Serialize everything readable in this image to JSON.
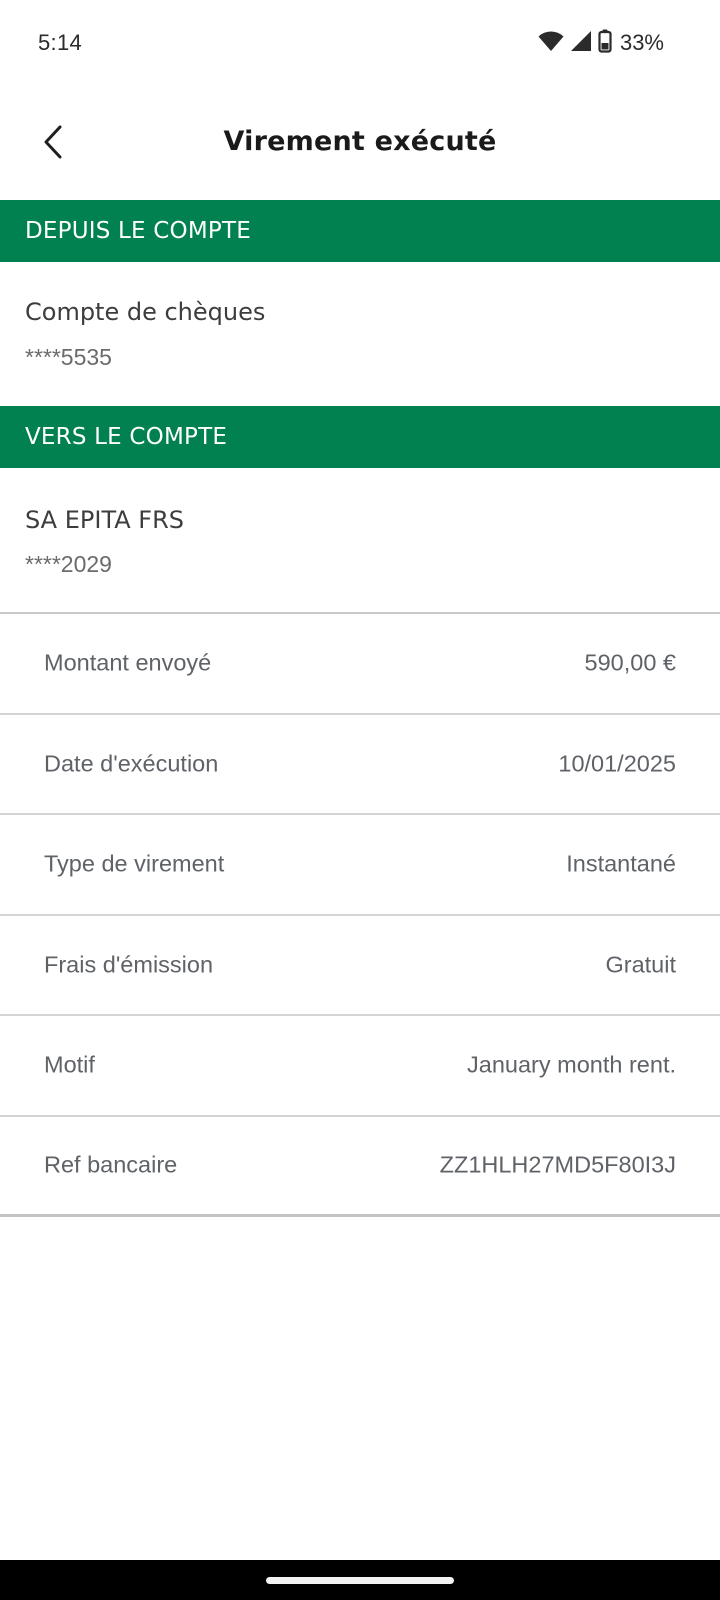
{
  "status_bar": {
    "time": "5:14",
    "battery_percent": "33%",
    "icons": [
      "wifi-icon",
      "signal-icon",
      "battery-icon"
    ]
  },
  "header": {
    "title": "Virement exécuté",
    "back_icon": "chevron-left-icon"
  },
  "from_account": {
    "section_label": "DEPUIS LE COMPTE",
    "name": "Compte de chèques",
    "number": "****5535"
  },
  "to_account": {
    "section_label": "VERS LE COMPTE",
    "name": "SA EPITA FRS",
    "number": "****2029"
  },
  "details": [
    {
      "label": "Montant envoyé",
      "value": "590,00 €"
    },
    {
      "label": "Date d'exécution",
      "value": "10/01/2025"
    },
    {
      "label": "Type de virement",
      "value": "Instantané"
    },
    {
      "label": "Frais d'émission",
      "value": "Gratuit"
    },
    {
      "label": "Motif",
      "value": "January month rent."
    },
    {
      "label": "Ref bancaire",
      "value": "ZZ1HLH27MD5F80I3J"
    }
  ],
  "colors": {
    "accent_green": "#00814f",
    "text_dark": "#1a1a1a",
    "text_muted": "#5f6368",
    "divider": "#d4d4d4"
  }
}
